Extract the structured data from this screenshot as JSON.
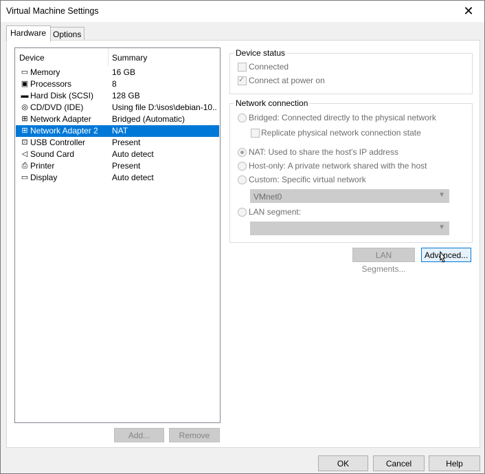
{
  "window": {
    "title": "Virtual Machine Settings"
  },
  "tabs": [
    {
      "label": "Hardware"
    },
    {
      "label": "Options"
    }
  ],
  "device_list": {
    "columns": {
      "device": "Device",
      "summary": "Summary"
    },
    "rows": [
      {
        "icon": "memory-icon",
        "glyph": "▭",
        "device": "Memory",
        "summary": "16 GB"
      },
      {
        "icon": "processor-icon",
        "glyph": "▣",
        "device": "Processors",
        "summary": "8"
      },
      {
        "icon": "hard-disk-icon",
        "glyph": "▬",
        "device": "Hard Disk (SCSI)",
        "summary": "128 GB"
      },
      {
        "icon": "cd-dvd-icon",
        "glyph": "◎",
        "device": "CD/DVD (IDE)",
        "summary": "Using file D:\\isos\\debian-10...."
      },
      {
        "icon": "network-adapter-icon",
        "glyph": "⊞",
        "device": "Network Adapter",
        "summary": "Bridged (Automatic)"
      },
      {
        "icon": "network-adapter-icon",
        "glyph": "⊞",
        "device": "Network Adapter 2",
        "summary": "NAT"
      },
      {
        "icon": "usb-icon",
        "glyph": "⊡",
        "device": "USB Controller",
        "summary": "Present"
      },
      {
        "icon": "speaker-icon",
        "glyph": "◁",
        "device": "Sound Card",
        "summary": "Auto detect"
      },
      {
        "icon": "printer-icon",
        "glyph": "⎙",
        "device": "Printer",
        "summary": "Present"
      },
      {
        "icon": "display-icon",
        "glyph": "▭",
        "device": "Display",
        "summary": "Auto detect"
      }
    ],
    "selected_index": 5,
    "add_label": "Add...",
    "remove_label": "Remove"
  },
  "device_status": {
    "label": "Device status",
    "connected": {
      "label": "Connected",
      "checked": false
    },
    "connect_at_power_on": {
      "label": "Connect at power on",
      "checked": true
    }
  },
  "network_connection": {
    "label": "Network connection",
    "bridged": "Bridged: Connected directly to the physical network",
    "replicate": "Replicate physical network connection state",
    "nat": "NAT: Used to share the host's IP address",
    "host_only": "Host-only: A private network shared with the host",
    "custom": "Custom: Specific virtual network",
    "custom_value": "VMnet0",
    "lan_segment": "LAN segment:",
    "lan_value": "",
    "selected": "nat"
  },
  "lan_segments_label": "LAN Segments...",
  "advanced_label": "Advanced...",
  "footer": {
    "ok": "OK",
    "cancel": "Cancel",
    "help": "Help"
  },
  "colors": {
    "selection": "#0078d7",
    "disabled_text": "#6d6d6d"
  }
}
